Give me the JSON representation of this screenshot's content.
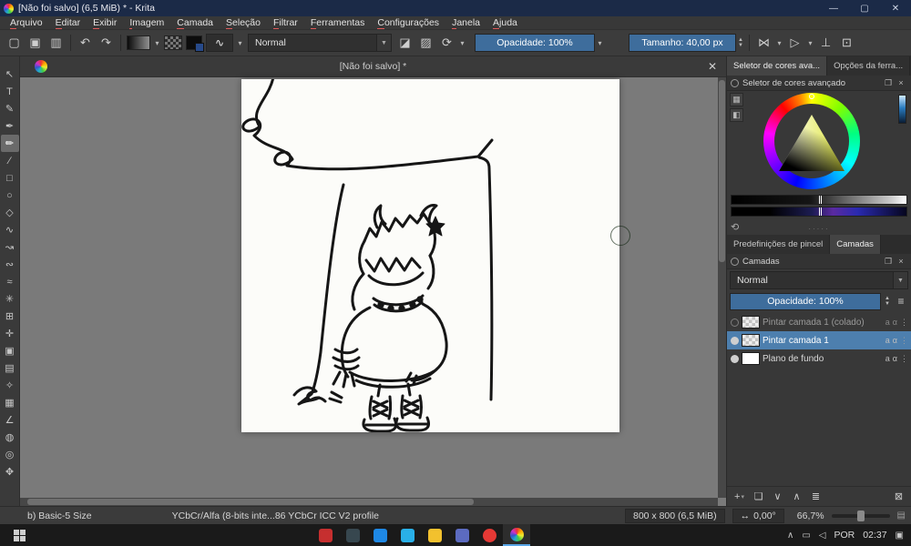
{
  "window": {
    "title": "[Não foi salvo] (6,5 MiB) * - Krita"
  },
  "menubar": {
    "items": [
      {
        "accel": "A",
        "rest": "rquivo"
      },
      {
        "accel": "E",
        "rest": "ditar"
      },
      {
        "accel": "E",
        "rest": "xibir"
      },
      {
        "accel": "I",
        "rest": "magem"
      },
      {
        "accel": "C",
        "rest": "amada"
      },
      {
        "accel": "S",
        "rest": "eleção"
      },
      {
        "accel": "F",
        "rest": "iltrar"
      },
      {
        "accel": "F",
        "rest": "erramentas"
      },
      {
        "accel": "C",
        "rest": "onfigurações"
      },
      {
        "accel": "J",
        "rest": "anela"
      },
      {
        "accel": "A",
        "rest": "juda"
      }
    ]
  },
  "toolbar": {
    "blend_mode": "Normal",
    "opacity_label": "Opacidade: 100%",
    "size_label": "Tamanho: 40,00 px"
  },
  "toolbox": {
    "tools": [
      {
        "name": "select-shapes-tool",
        "glyph": "↖"
      },
      {
        "name": "text-tool",
        "glyph": "T"
      },
      {
        "name": "edit-shapes-tool",
        "glyph": "✎"
      },
      {
        "name": "calligraphy-tool",
        "glyph": "✒"
      },
      {
        "name": "freehand-brush-tool",
        "glyph": "✏",
        "state": "active"
      },
      {
        "name": "line-tool",
        "glyph": "∕"
      },
      {
        "name": "rectangle-tool",
        "glyph": "□"
      },
      {
        "name": "ellipse-tool",
        "glyph": "○"
      },
      {
        "name": "polygon-tool",
        "glyph": "◇"
      },
      {
        "name": "polyline-tool",
        "glyph": "∿"
      },
      {
        "name": "bezier-curve-tool",
        "glyph": "↝"
      },
      {
        "name": "freehand-path-tool",
        "glyph": "∾"
      },
      {
        "name": "dynamic-brush-tool",
        "glyph": "≈"
      },
      {
        "name": "multibrush-tool",
        "glyph": "✳"
      },
      {
        "name": "transform-tool",
        "glyph": "⊞"
      },
      {
        "name": "move-tool",
        "glyph": "✛"
      },
      {
        "name": "crop-tool",
        "glyph": "▣"
      },
      {
        "name": "gradient-tool",
        "glyph": "▤"
      },
      {
        "name": "color-sampler-tool",
        "glyph": "✧"
      },
      {
        "name": "pattern-edit-tool",
        "glyph": "▦"
      },
      {
        "name": "measure-tool",
        "glyph": "∠"
      },
      {
        "name": "fill-tool",
        "glyph": "◍"
      },
      {
        "name": "zoom-tool",
        "glyph": "◎"
      },
      {
        "name": "pan-tool",
        "glyph": "✥"
      }
    ]
  },
  "document": {
    "tab_title": "[Não foi salvo] *"
  },
  "right_panel": {
    "top_tabs": [
      {
        "label": "Seletor de cores ava...",
        "state": "active"
      },
      {
        "label": "Opções da ferra..."
      }
    ],
    "color_docker_title": "Seletor de cores avançado",
    "bottom_tabs": [
      {
        "label": "Predefinições de pincel"
      },
      {
        "label": "Camadas",
        "state": "active"
      }
    ],
    "layers_docker_title": "Camadas",
    "blend_mode": "Normal",
    "opacity_label": "Opacidade:  100%",
    "layers": [
      {
        "name": "Pintar camada 1 (colado)",
        "row_state": "muted",
        "eye_state": "off",
        "thumb": "checker",
        "lock": "a",
        "alpha": "α",
        "dots": "⋮"
      },
      {
        "name": "Pintar camada 1",
        "row_state": "selected",
        "eye_state": "on",
        "thumb": "checker",
        "lock": "a",
        "alpha": "α",
        "dots": "⋮"
      },
      {
        "name": "Plano de fundo",
        "row_state": "",
        "eye_state": "on",
        "thumb": "white",
        "lock": "a",
        "alpha": "α",
        "dots": "⋮"
      }
    ]
  },
  "statusbar": {
    "brush_preset": "b) Basic-5 Size",
    "color_profile": "YCbCr/Alfa (8-bits inte...86 YCbCr ICC V2 profile",
    "image_size": "800 x 800 (6,5 MiB)",
    "angle": "0,00°",
    "zoom": "66,7%"
  },
  "taskbar": {
    "language": "POR",
    "time": "02:37",
    "apps": [
      {
        "name": "taskbar-app-red",
        "color": "#c62f2f"
      },
      {
        "name": "taskbar-app-dark",
        "color": "#37474f"
      },
      {
        "name": "taskbar-app-calendar",
        "color": "#1e88e5"
      },
      {
        "name": "taskbar-app-telegram",
        "color": "#29b0e8"
      },
      {
        "name": "taskbar-app-folder",
        "color": "#f2c12e"
      },
      {
        "name": "taskbar-app-discord",
        "color": "#5c6bc0"
      },
      {
        "name": "taskbar-app-opera",
        "color": "#e53935",
        "shape": "round"
      },
      {
        "name": "taskbar-app-krita",
        "color": "conic-gradient(#e33,#fa0,#ee3,#4c4,#2ac,#35c,#c3c,#e33)",
        "shape": "round",
        "state": "active"
      }
    ]
  },
  "icons": {
    "minimize": "—",
    "maximize": "▢",
    "close": "✕",
    "new_doc": "▢",
    "open": "▣",
    "save": "▥",
    "undo": "↶",
    "redo": "↷",
    "brush_preview": "∿",
    "dropdown": "▾",
    "combo_arrow": "▼",
    "eraser": "◪",
    "preserve_alpha": "▨",
    "reload": "⟳",
    "mirror": "⋈",
    "wrap": "▷",
    "snap": "⊥",
    "grid_assist": "⊡",
    "float": "❐",
    "dock_close": "×",
    "settings_grid": "▦",
    "settings_blank": "◧",
    "refresh": "⟲",
    "dots": "·····",
    "menu": "≡",
    "add": "+",
    "duplicate": "❏",
    "arrow_down": "∨",
    "arrow_up": "∧",
    "properties": "≣",
    "delete": "⊠",
    "doc_close": "✕",
    "angle_arrows": "↔",
    "grip": "▤",
    "tray_chevron": "∧",
    "tray_display": "▭",
    "tray_volume": "◁",
    "tray_notif": "▣",
    "spin_up": "▲",
    "spin_down": "▼"
  },
  "colors": {
    "titlebar": "#1b2a47",
    "accent_slider": "#3e6d9c",
    "layer_selected": "#4d7fae",
    "canvas_surround": "#7a7a7a",
    "taskbar_active_underline": "#5aa7e8"
  }
}
